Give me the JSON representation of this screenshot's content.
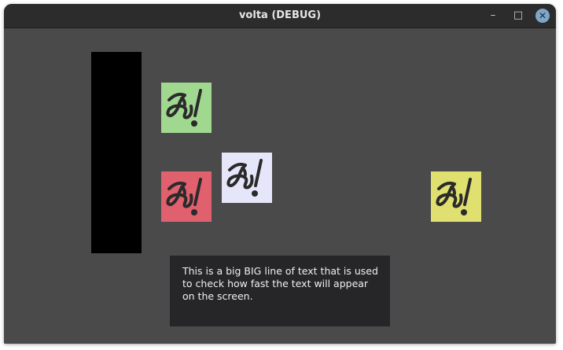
{
  "window": {
    "title": "volta (DEBUG)",
    "controls": {
      "minimize_glyph": "–",
      "maximize_glyph": "□",
      "close_glyph": "✕"
    }
  },
  "scene": {
    "background_color": "#4a4a4a",
    "panel_color": "#000000",
    "sprites": [
      {
        "name": "sprite-green",
        "icon": "logo-glyph-icon",
        "tint": "#a0d890"
      },
      {
        "name": "sprite-red",
        "icon": "logo-glyph-icon",
        "tint": "#e0606e"
      },
      {
        "name": "sprite-lilac",
        "icon": "logo-glyph-icon",
        "tint": "#e6e6fa"
      },
      {
        "name": "sprite-yellow",
        "icon": "logo-glyph-icon",
        "tint": "#e0e070"
      }
    ],
    "dialog": {
      "text": "This is a big BIG line of text that is used to check how fast the text will appear on the screen.",
      "background_color": "#262528"
    }
  }
}
